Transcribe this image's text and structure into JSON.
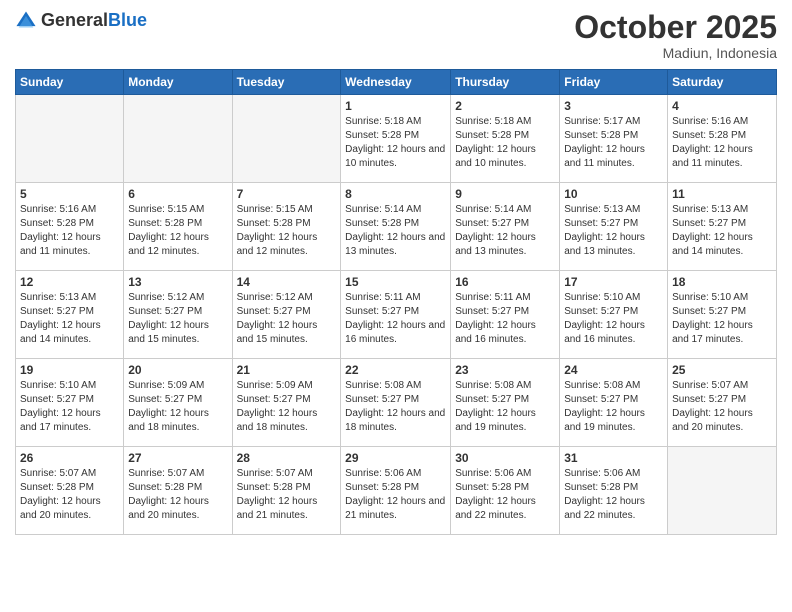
{
  "header": {
    "logo_general": "General",
    "logo_blue": "Blue",
    "month_title": "October 2025",
    "subtitle": "Madiun, Indonesia"
  },
  "weekdays": [
    "Sunday",
    "Monday",
    "Tuesday",
    "Wednesday",
    "Thursday",
    "Friday",
    "Saturday"
  ],
  "weeks": [
    [
      {
        "day": "",
        "info": ""
      },
      {
        "day": "",
        "info": ""
      },
      {
        "day": "",
        "info": ""
      },
      {
        "day": "1",
        "info": "Sunrise: 5:18 AM\nSunset: 5:28 PM\nDaylight: 12 hours and 10 minutes."
      },
      {
        "day": "2",
        "info": "Sunrise: 5:18 AM\nSunset: 5:28 PM\nDaylight: 12 hours and 10 minutes."
      },
      {
        "day": "3",
        "info": "Sunrise: 5:17 AM\nSunset: 5:28 PM\nDaylight: 12 hours and 11 minutes."
      },
      {
        "day": "4",
        "info": "Sunrise: 5:16 AM\nSunset: 5:28 PM\nDaylight: 12 hours and 11 minutes."
      }
    ],
    [
      {
        "day": "5",
        "info": "Sunrise: 5:16 AM\nSunset: 5:28 PM\nDaylight: 12 hours and 11 minutes."
      },
      {
        "day": "6",
        "info": "Sunrise: 5:15 AM\nSunset: 5:28 PM\nDaylight: 12 hours and 12 minutes."
      },
      {
        "day": "7",
        "info": "Sunrise: 5:15 AM\nSunset: 5:28 PM\nDaylight: 12 hours and 12 minutes."
      },
      {
        "day": "8",
        "info": "Sunrise: 5:14 AM\nSunset: 5:28 PM\nDaylight: 12 hours and 13 minutes."
      },
      {
        "day": "9",
        "info": "Sunrise: 5:14 AM\nSunset: 5:27 PM\nDaylight: 12 hours and 13 minutes."
      },
      {
        "day": "10",
        "info": "Sunrise: 5:13 AM\nSunset: 5:27 PM\nDaylight: 12 hours and 13 minutes."
      },
      {
        "day": "11",
        "info": "Sunrise: 5:13 AM\nSunset: 5:27 PM\nDaylight: 12 hours and 14 minutes."
      }
    ],
    [
      {
        "day": "12",
        "info": "Sunrise: 5:13 AM\nSunset: 5:27 PM\nDaylight: 12 hours and 14 minutes."
      },
      {
        "day": "13",
        "info": "Sunrise: 5:12 AM\nSunset: 5:27 PM\nDaylight: 12 hours and 15 minutes."
      },
      {
        "day": "14",
        "info": "Sunrise: 5:12 AM\nSunset: 5:27 PM\nDaylight: 12 hours and 15 minutes."
      },
      {
        "day": "15",
        "info": "Sunrise: 5:11 AM\nSunset: 5:27 PM\nDaylight: 12 hours and 16 minutes."
      },
      {
        "day": "16",
        "info": "Sunrise: 5:11 AM\nSunset: 5:27 PM\nDaylight: 12 hours and 16 minutes."
      },
      {
        "day": "17",
        "info": "Sunrise: 5:10 AM\nSunset: 5:27 PM\nDaylight: 12 hours and 16 minutes."
      },
      {
        "day": "18",
        "info": "Sunrise: 5:10 AM\nSunset: 5:27 PM\nDaylight: 12 hours and 17 minutes."
      }
    ],
    [
      {
        "day": "19",
        "info": "Sunrise: 5:10 AM\nSunset: 5:27 PM\nDaylight: 12 hours and 17 minutes."
      },
      {
        "day": "20",
        "info": "Sunrise: 5:09 AM\nSunset: 5:27 PM\nDaylight: 12 hours and 18 minutes."
      },
      {
        "day": "21",
        "info": "Sunrise: 5:09 AM\nSunset: 5:27 PM\nDaylight: 12 hours and 18 minutes."
      },
      {
        "day": "22",
        "info": "Sunrise: 5:08 AM\nSunset: 5:27 PM\nDaylight: 12 hours and 18 minutes."
      },
      {
        "day": "23",
        "info": "Sunrise: 5:08 AM\nSunset: 5:27 PM\nDaylight: 12 hours and 19 minutes."
      },
      {
        "day": "24",
        "info": "Sunrise: 5:08 AM\nSunset: 5:27 PM\nDaylight: 12 hours and 19 minutes."
      },
      {
        "day": "25",
        "info": "Sunrise: 5:07 AM\nSunset: 5:27 PM\nDaylight: 12 hours and 20 minutes."
      }
    ],
    [
      {
        "day": "26",
        "info": "Sunrise: 5:07 AM\nSunset: 5:28 PM\nDaylight: 12 hours and 20 minutes."
      },
      {
        "day": "27",
        "info": "Sunrise: 5:07 AM\nSunset: 5:28 PM\nDaylight: 12 hours and 20 minutes."
      },
      {
        "day": "28",
        "info": "Sunrise: 5:07 AM\nSunset: 5:28 PM\nDaylight: 12 hours and 21 minutes."
      },
      {
        "day": "29",
        "info": "Sunrise: 5:06 AM\nSunset: 5:28 PM\nDaylight: 12 hours and 21 minutes."
      },
      {
        "day": "30",
        "info": "Sunrise: 5:06 AM\nSunset: 5:28 PM\nDaylight: 12 hours and 22 minutes."
      },
      {
        "day": "31",
        "info": "Sunrise: 5:06 AM\nSunset: 5:28 PM\nDaylight: 12 hours and 22 minutes."
      },
      {
        "day": "",
        "info": ""
      }
    ]
  ]
}
